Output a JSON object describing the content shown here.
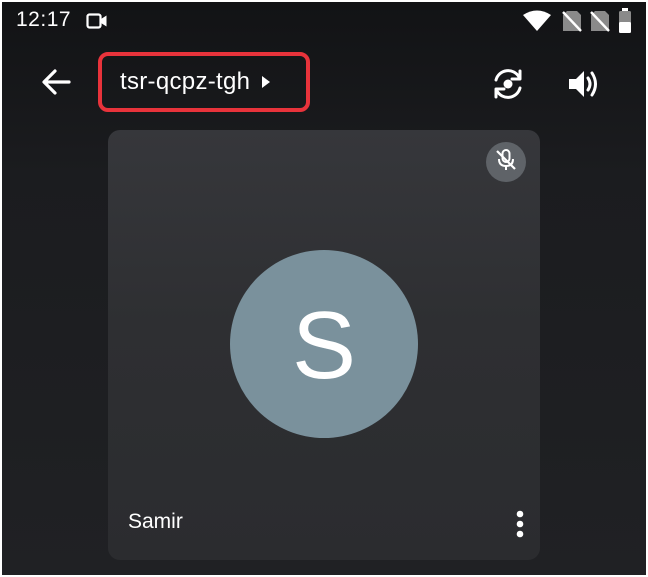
{
  "status_bar": {
    "time": "12:17",
    "icons": [
      "video-camera-icon",
      "wifi-icon",
      "no-sim-icon",
      "no-sim-icon",
      "battery-icon"
    ]
  },
  "app_bar": {
    "back_icon": "arrow-back-icon",
    "meeting_code": "tsr-qcpz-tgh",
    "switch_camera_icon": "switch-camera-icon",
    "speaker_icon": "volume-icon",
    "highlight_color": "#e8333b"
  },
  "participant": {
    "name": "Samir",
    "initial": "S",
    "avatar_color": "#7a919c",
    "muted": true,
    "mute_icon": "mic-off-icon",
    "more_icon": "more-vert-icon"
  }
}
